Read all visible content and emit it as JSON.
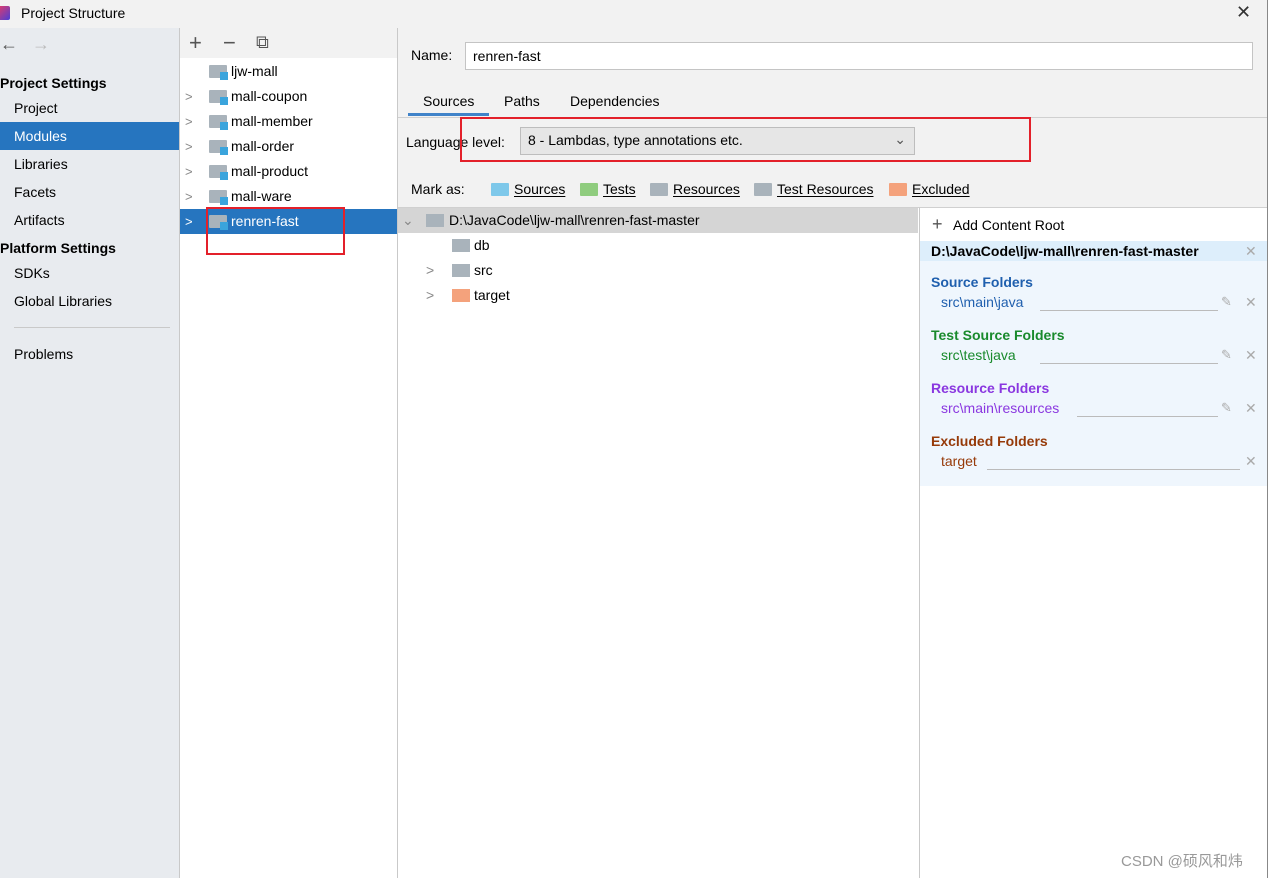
{
  "window": {
    "title": "Project Structure",
    "close": "✕"
  },
  "sidebar": {
    "back": "←",
    "forward": "→",
    "project_settings": "Project Settings",
    "items": [
      {
        "label": "Project"
      },
      {
        "label": "Modules"
      },
      {
        "label": "Libraries"
      },
      {
        "label": "Facets"
      },
      {
        "label": "Artifacts"
      }
    ],
    "platform_settings": "Platform Settings",
    "platform_items": [
      {
        "label": "SDKs"
      },
      {
        "label": "Global Libraries"
      }
    ],
    "problems": "Problems"
  },
  "modules": {
    "add": "+",
    "remove": "−",
    "copy": "⧉",
    "items": [
      {
        "label": "ljw-mall",
        "expandable": false
      },
      {
        "label": "mall-coupon",
        "expandable": true
      },
      {
        "label": "mall-member",
        "expandable": true
      },
      {
        "label": "mall-order",
        "expandable": true
      },
      {
        "label": "mall-product",
        "expandable": true
      },
      {
        "label": "mall-ware",
        "expandable": true
      },
      {
        "label": "renren-fast",
        "expandable": true,
        "selected": true
      }
    ]
  },
  "main": {
    "name_label": "Name:",
    "name_value": "renren-fast",
    "tabs": [
      {
        "label": "Sources",
        "selected": true
      },
      {
        "label": "Paths"
      },
      {
        "label": "Dependencies"
      }
    ],
    "language_level_label": "Language level:",
    "language_level_value": "8 - Lambdas, type annotations etc.",
    "mark_as_label": "Mark as:",
    "mark_as": [
      {
        "label": "Sources",
        "color": "#7ec8ea"
      },
      {
        "label": "Tests",
        "color": "#8fcc7e"
      },
      {
        "label": "Resources",
        "color": "#a9b3bb"
      },
      {
        "label": "Test Resources",
        "color": "#a9b3bb"
      },
      {
        "label": "Excluded",
        "color": "#f4a27c"
      }
    ]
  },
  "tree": {
    "root": "D:\\JavaCode\\ljw-mall\\renren-fast-master",
    "children": [
      {
        "label": "db",
        "color": "#a9b3bb",
        "expandable": false
      },
      {
        "label": "src",
        "color": "#a9b3bb",
        "expandable": true
      },
      {
        "label": "target",
        "color": "#f4a27c",
        "expandable": true
      }
    ]
  },
  "roots": {
    "add_label": "Add Content Root",
    "root_path": "D:\\JavaCode\\ljw-mall\\renren-fast-master",
    "sections": [
      {
        "title": "Source Folders",
        "path": "src\\main\\java",
        "color": "#1f5fae"
      },
      {
        "title": "Test Source Folders",
        "path": "src\\test\\java",
        "color": "#198a2c"
      },
      {
        "title": "Resource Folders",
        "path": "src\\main\\resources",
        "color": "#8a37e0"
      },
      {
        "title": "Excluded Folders",
        "path": "target",
        "color": "#963a09"
      }
    ]
  },
  "watermark": "CSDN @硕风和炜"
}
